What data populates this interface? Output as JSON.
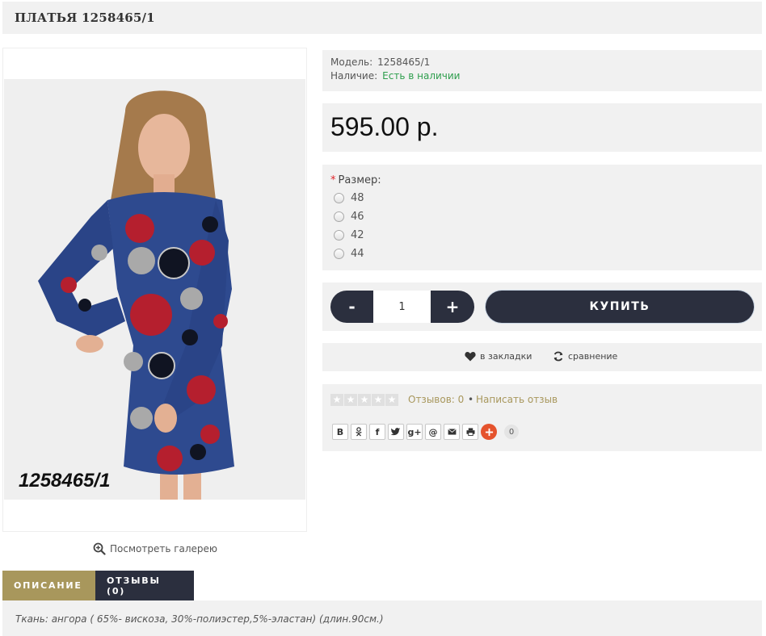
{
  "product": {
    "title": "ПЛАТЬЯ 1258465/1",
    "image_caption": "1258465/1",
    "gallery_link": "Посмотреть галерею",
    "model_label": "Модель:",
    "model_value": "1258465/1",
    "stock_label": "Наличие:",
    "stock_value": "Есть в наличии",
    "price": "595.00 р."
  },
  "options": {
    "required_mark": "*",
    "size_label": "Размер:",
    "sizes": [
      "48",
      "46",
      "42",
      "44"
    ]
  },
  "cart": {
    "minus": "-",
    "plus": "+",
    "quantity": "1",
    "buy_label": "КУПИТЬ"
  },
  "actions": {
    "wishlist_label": "в закладки",
    "compare_label": "сравнение"
  },
  "reviews": {
    "rating_stars": 0,
    "reviews_link": "Отзывов: 0",
    "separator": "•",
    "write_link": "Написать отзыв"
  },
  "share": {
    "buttons": [
      "В",
      "ok",
      "f",
      "t",
      "g+",
      "@",
      "mail",
      "print"
    ],
    "counter": "0"
  },
  "tabs": {
    "description": "ОПИСАНИЕ",
    "reviews": "ОТЗЫВЫ (0)"
  },
  "description": {
    "text": "Ткань: ангора ( 65%- вискоза, 30%-полиэстер,5%-эластан) (длин.90см.)"
  },
  "colors": {
    "dark": "#2b2f3e",
    "accent": "#a8975c",
    "stock_green": "#2e9e4d",
    "panel_bg": "#f1f1f1",
    "share_plus": "#e5532d"
  }
}
